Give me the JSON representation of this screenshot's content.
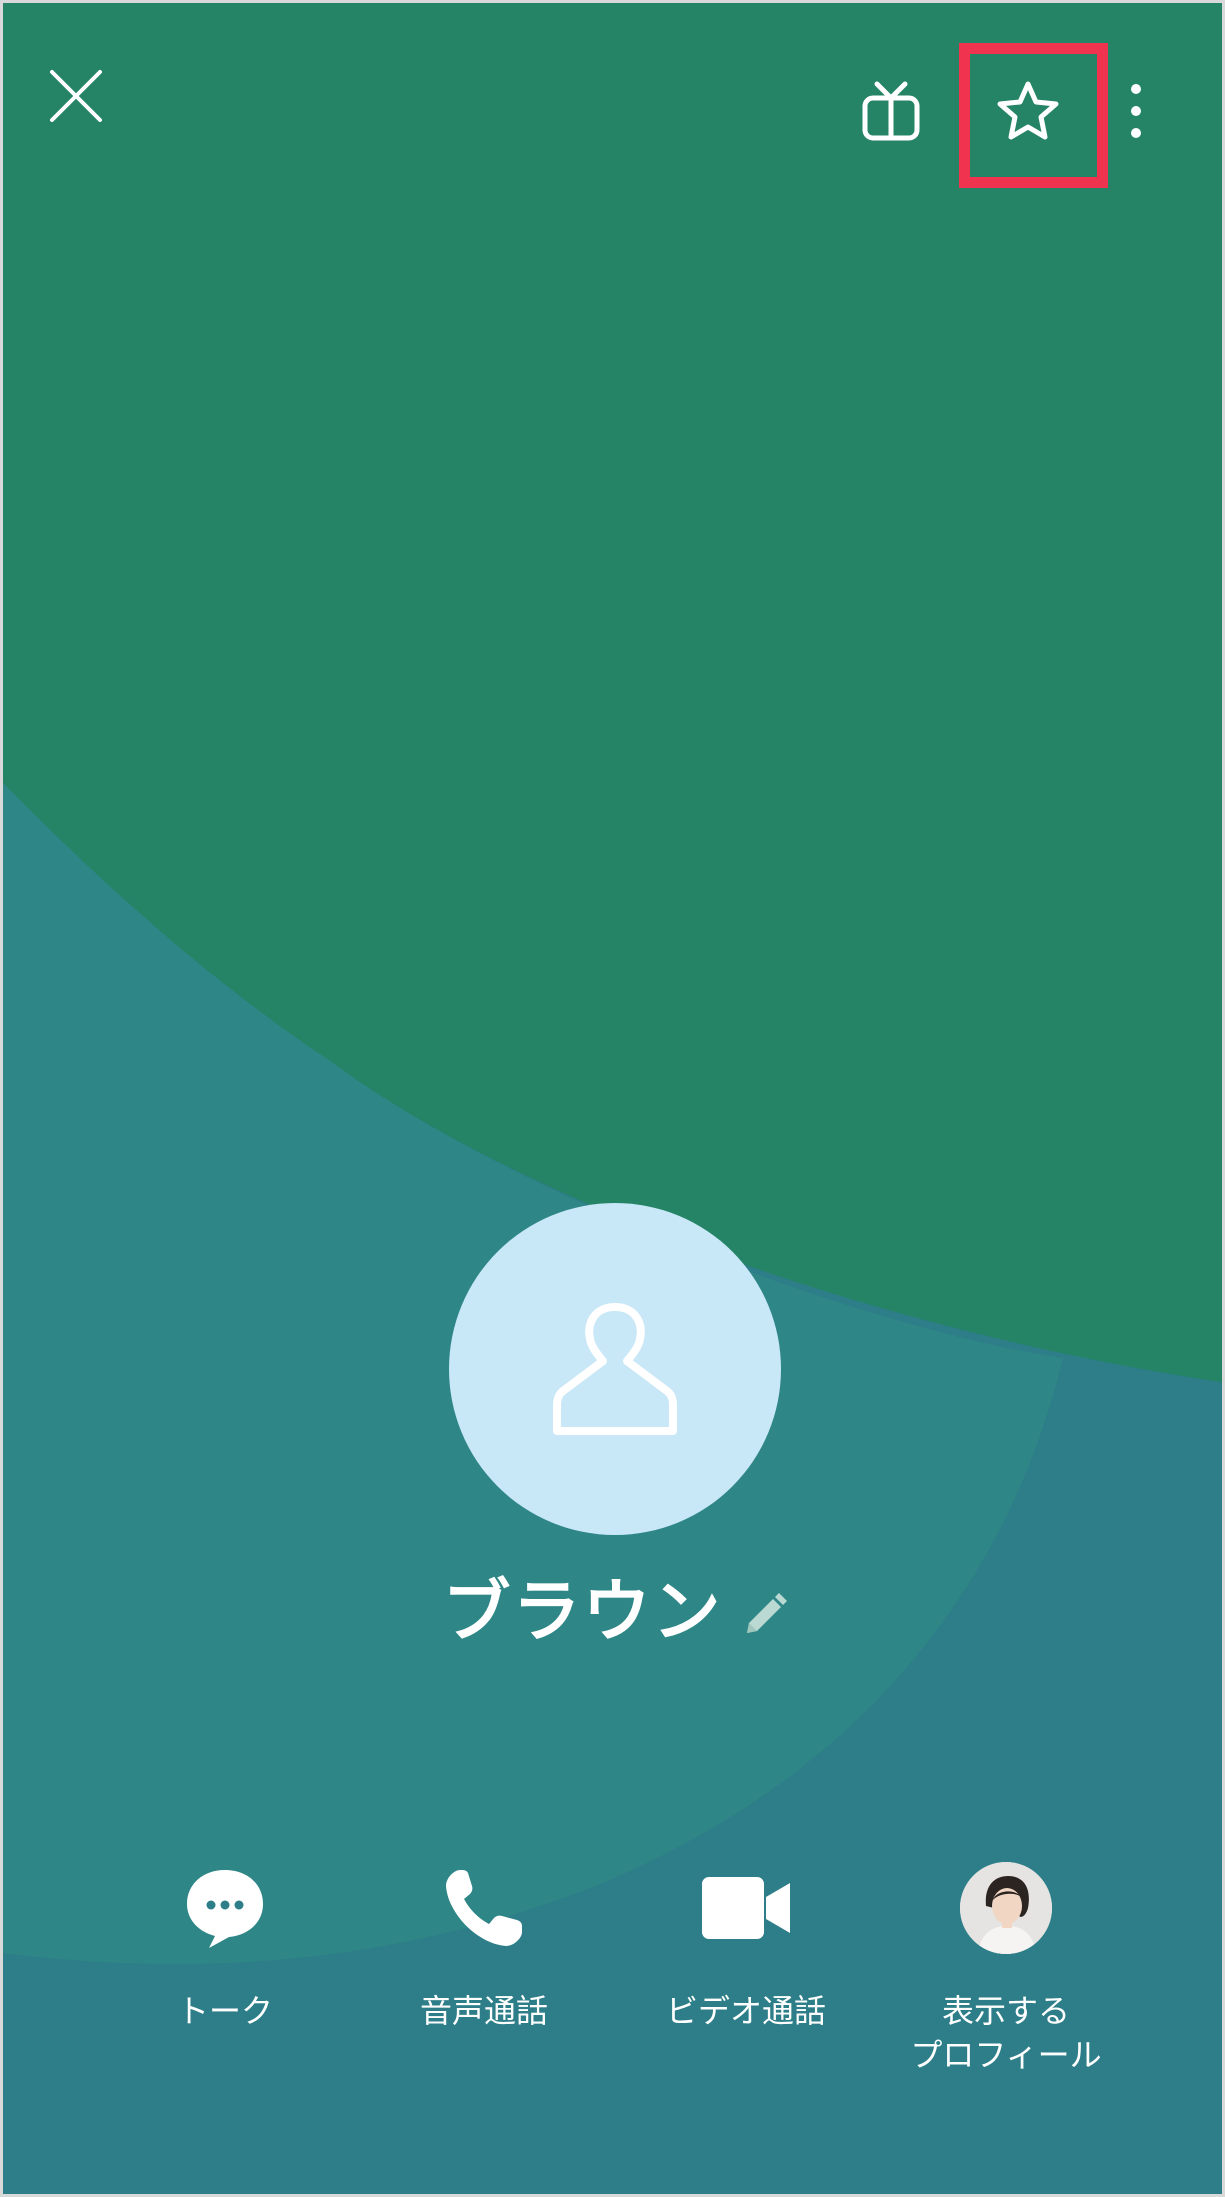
{
  "header": {
    "close_icon": "close-icon",
    "gift_icon": "gift-icon",
    "favorite_icon": "star-icon",
    "more_icon": "more-vertical-icon",
    "highlight_color": "#f0334f"
  },
  "background": {
    "top_color": "#248465",
    "bottom_color": "#2e7d88"
  },
  "profile": {
    "name": "ブラウン",
    "avatar_icon": "person-icon",
    "edit_icon": "pencil-icon",
    "avatar_color": "#c8e7f7"
  },
  "actions": [
    {
      "label": "トーク",
      "icon": "chat-bubble-icon"
    },
    {
      "label": "音声通話",
      "icon": "phone-icon"
    },
    {
      "label": "ビデオ通話",
      "icon": "video-camera-icon"
    },
    {
      "label_line1": "表示する",
      "label_line2": "プロフィール",
      "icon": "profile-photo"
    }
  ]
}
